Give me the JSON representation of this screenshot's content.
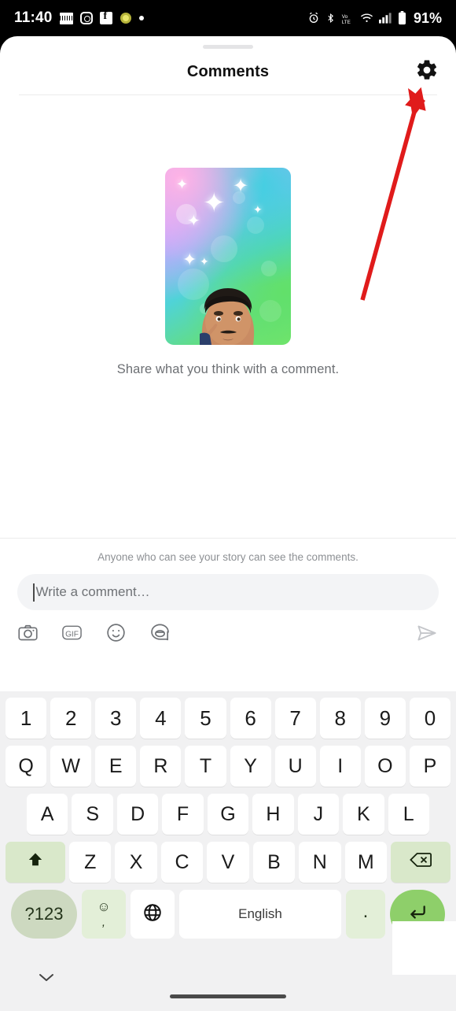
{
  "status_bar": {
    "time": "11:40",
    "battery_percent": "91%",
    "left_icons": [
      "screenshot-icon",
      "instagram-icon",
      "facebook-icon",
      "app-icon",
      "dot-icon"
    ],
    "right_icons": [
      "alarm-icon",
      "bluetooth-icon",
      "volte-icon",
      "wifi-icon",
      "signal-icon",
      "battery-icon"
    ]
  },
  "header": {
    "title": "Comments",
    "settings_icon": "gear-icon"
  },
  "empty_state": {
    "message": "Share what you think with a comment.",
    "card": {
      "type": "avatar-sparkle-card",
      "gradient_from": "#f09ae0",
      "gradient_mid": "#4fd3d8",
      "gradient_to": "#7de86a"
    }
  },
  "composer": {
    "privacy_note": "Anyone who can see your story can see the comments.",
    "input_placeholder": "Write a comment…",
    "input_value": "",
    "tools": [
      {
        "name": "camera-icon",
        "label": "Camera"
      },
      {
        "name": "gif-icon",
        "label": "GIF"
      },
      {
        "name": "emoji-icon",
        "label": "Emoji"
      },
      {
        "name": "sticker-icon",
        "label": "Sticker"
      }
    ],
    "send_icon": "send-icon"
  },
  "keyboard": {
    "row_digits": [
      "1",
      "2",
      "3",
      "4",
      "5",
      "6",
      "7",
      "8",
      "9",
      "0"
    ],
    "row_qwerty": [
      "Q",
      "W",
      "E",
      "R",
      "T",
      "Y",
      "U",
      "I",
      "O",
      "P"
    ],
    "row_asdf": [
      "A",
      "S",
      "D",
      "F",
      "G",
      "H",
      "J",
      "K",
      "L"
    ],
    "row_zxcv": [
      "Z",
      "X",
      "C",
      "V",
      "B",
      "N",
      "M"
    ],
    "shift_icon": "shift-icon",
    "backspace_icon": "backspace-icon",
    "symbols_label": "?123",
    "emoji_key": {
      "top": "☺",
      "bottom": ","
    },
    "globe_icon": "globe-icon",
    "space_label": "English",
    "period_label": ".",
    "enter_icon": "enter-icon",
    "hide_icon": "chevron-down-icon",
    "key_bg": "#ffffff",
    "fn_key_bg": "#d9e8ca",
    "symbols_key_bg": "#cdd9c0",
    "enter_key_bg": "#8ecf6a",
    "keyboard_bg": "#f1f1f2"
  },
  "annotation": {
    "type": "arrow",
    "color": "#e01b1b",
    "points_to": "gear-icon"
  }
}
